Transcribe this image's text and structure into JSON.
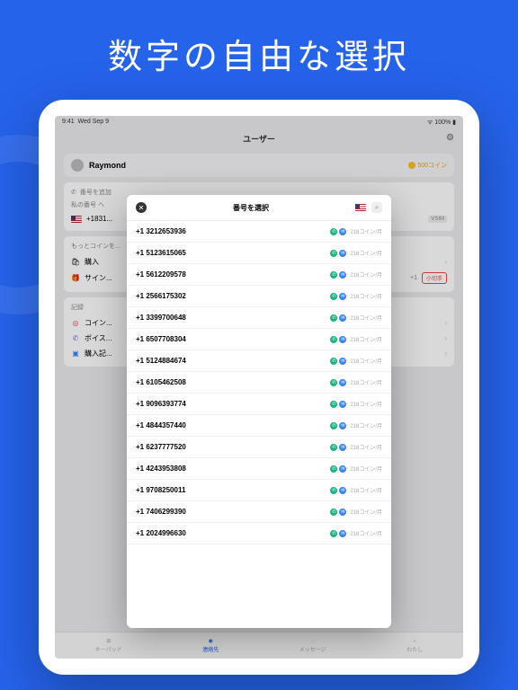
{
  "hero": "数字の自由な選択",
  "status": {
    "time": "9:41",
    "date": "Wed Sep 9",
    "battery": "100%"
  },
  "nav": {
    "title": "ユーザー"
  },
  "user": {
    "name": "Raymond",
    "coins": "500コイン"
  },
  "addNumber": "番号を追加",
  "myNumber": "私の番号 へ",
  "currentNumber": "+1831...",
  "vsim": "VSIM",
  "moreCoins": "もっとコインを...",
  "buy": "購入",
  "signin": "サイン...",
  "plus1": "+1",
  "smallCut": "小切手",
  "records": "記録",
  "coinRec": "コイン...",
  "voice": "ボイス...",
  "buyRec": "購入記...",
  "modal": {
    "title": "番号を選択"
  },
  "numbers": [
    {
      "phone": "+1 3212653936",
      "price": "218コイン/月"
    },
    {
      "phone": "+1 5123615065",
      "price": "218コイン/月"
    },
    {
      "phone": "+1 5612209578",
      "price": "218コイン/月"
    },
    {
      "phone": "+1 2566175302",
      "price": "218コイン/月"
    },
    {
      "phone": "+1 3399700648",
      "price": "218コイン/月"
    },
    {
      "phone": "+1 6507708304",
      "price": "218コイン/月"
    },
    {
      "phone": "+1 5124884674",
      "price": "218コイン/月"
    },
    {
      "phone": "+1 6105462508",
      "price": "218コイン/月"
    },
    {
      "phone": "+1 9096393774",
      "price": "218コイン/月"
    },
    {
      "phone": "+1 4844357440",
      "price": "218コイン/月"
    },
    {
      "phone": "+1 6237777520",
      "price": "218コイン/月"
    },
    {
      "phone": "+1 4243953808",
      "price": "218コイン/月"
    },
    {
      "phone": "+1 9708250011",
      "price": "218コイン/月"
    },
    {
      "phone": "+1 7406299390",
      "price": "218コイン/月"
    },
    {
      "phone": "+1 2024996630",
      "price": "218コイン/月"
    }
  ],
  "tabs": {
    "keypad": "キーパッド",
    "contacts": "連絡先",
    "messages": "メッセージ",
    "me": "わたし"
  }
}
